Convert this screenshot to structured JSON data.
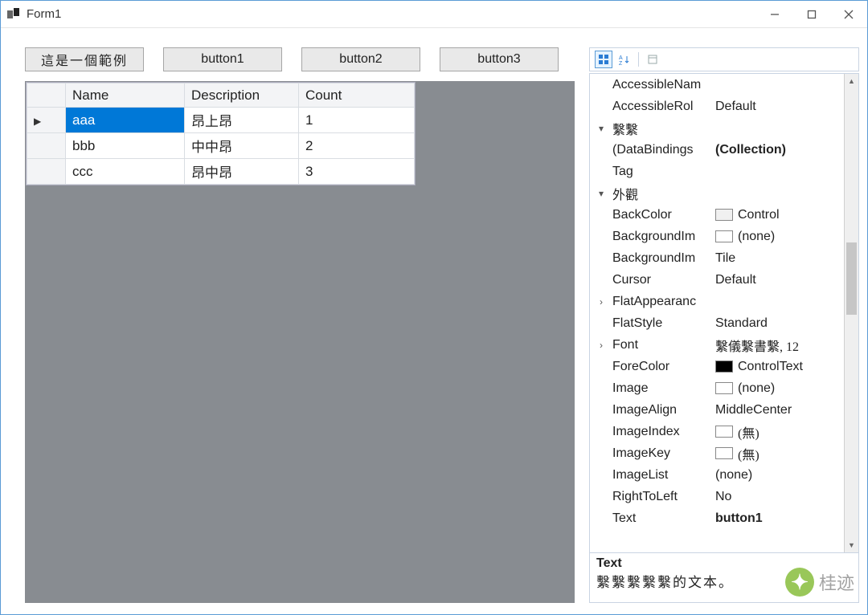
{
  "window": {
    "title": "Form1"
  },
  "buttons": [
    "這是一個範例",
    "button1",
    "button2",
    "button3"
  ],
  "grid": {
    "columns": [
      "Name",
      "Description",
      "Count"
    ],
    "rows": [
      {
        "name": "aaa",
        "desc": "昂上昂",
        "count": "1",
        "selected": true
      },
      {
        "name": "bbb",
        "desc": "中中昂",
        "count": "2",
        "selected": false
      },
      {
        "name": "ccc",
        "desc": "昂中昂",
        "count": "3",
        "selected": false
      }
    ]
  },
  "propgrid": {
    "rows": [
      {
        "kind": "prop",
        "gutter": "",
        "name": "AccessibleNam",
        "value": ""
      },
      {
        "kind": "prop",
        "gutter": "",
        "name": "AccessibleRol",
        "value": "Default"
      },
      {
        "kind": "cat",
        "gutter": "▾",
        "name": "繫繫"
      },
      {
        "kind": "prop",
        "gutter": "",
        "name": "(DataBindings",
        "value": "(Collection)",
        "bold": true
      },
      {
        "kind": "prop",
        "gutter": "",
        "name": "Tag",
        "value": ""
      },
      {
        "kind": "cat",
        "gutter": "▾",
        "name": "外觀"
      },
      {
        "kind": "prop",
        "gutter": "",
        "name": "BackColor",
        "value": "Control",
        "swatch": "#f0f0f0"
      },
      {
        "kind": "prop",
        "gutter": "",
        "name": "BackgroundIm",
        "value": "(none)",
        "swatch": "#ffffff"
      },
      {
        "kind": "prop",
        "gutter": "",
        "name": "BackgroundIm",
        "value": "Tile"
      },
      {
        "kind": "prop",
        "gutter": "",
        "name": "Cursor",
        "value": "Default"
      },
      {
        "kind": "prop",
        "gutter": "›",
        "name": "FlatAppearanc",
        "value": ""
      },
      {
        "kind": "prop",
        "gutter": "",
        "name": "FlatStyle",
        "value": "Standard"
      },
      {
        "kind": "prop",
        "gutter": "›",
        "name": "Font",
        "value": "繫儀繫書繫, 12",
        "cn": true
      },
      {
        "kind": "prop",
        "gutter": "",
        "name": "ForeColor",
        "value": "ControlText",
        "swatch": "#000000"
      },
      {
        "kind": "prop",
        "gutter": "",
        "name": "Image",
        "value": "(none)",
        "swatch": "#ffffff"
      },
      {
        "kind": "prop",
        "gutter": "",
        "name": "ImageAlign",
        "value": "MiddleCenter"
      },
      {
        "kind": "prop",
        "gutter": "",
        "name": "ImageIndex",
        "value": "(無)",
        "swatch": "#ffffff",
        "cn": true
      },
      {
        "kind": "prop",
        "gutter": "",
        "name": "ImageKey",
        "value": "(無)",
        "swatch": "#ffffff",
        "cn": true
      },
      {
        "kind": "prop",
        "gutter": "",
        "name": "ImageList",
        "value": "(none)"
      },
      {
        "kind": "prop",
        "gutter": "",
        "name": "RightToLeft",
        "value": "No"
      },
      {
        "kind": "prop",
        "gutter": "",
        "name": "Text",
        "value": "button1",
        "bold": true
      }
    ],
    "desc": {
      "title": "Text",
      "body": "繫繫繫繫繫的文本。"
    }
  },
  "watermark": "桂迹"
}
